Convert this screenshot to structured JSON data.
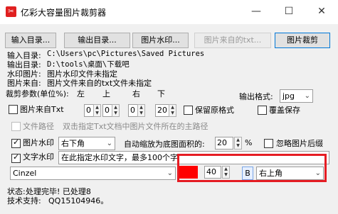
{
  "window": {
    "title": "亿彩大容量图片裁剪器",
    "controls": {
      "minimize": "—",
      "maximize": "☐",
      "close": "✕"
    }
  },
  "toolbar": {
    "input_dir": "输入目录...",
    "output_dir": "输出目录...",
    "watermark_image": "图片水印...",
    "from_txt": "图片来自的txt...",
    "crop": "图片裁剪"
  },
  "info": {
    "input_label": "输入目录:",
    "input_value": "C:\\Users\\pc\\Pictures\\Saved Pictures",
    "output_label": "输出目录:",
    "output_value": "D:\\tools\\桌面\\下载吧",
    "watermark_label": "水印图片:",
    "watermark_value": "图片水印文件未指定",
    "source_label": "图片来自:",
    "source_value": "图片文件来自的txt文件未指定"
  },
  "crop_params": {
    "label": "裁剪参数(单位%):",
    "left": "左",
    "top": "上",
    "right": "右",
    "bottom": "下",
    "values": [
      "0",
      "0",
      "0",
      "20"
    ]
  },
  "output_format": {
    "label": "输出格式:",
    "value": "jpg"
  },
  "options": {
    "from_txt": "图片来自Txt",
    "keep_format": "保留原格式",
    "overwrite": "覆盖保存",
    "file_path": "文件路径",
    "file_path_hint": "双击指定Txt文档中图片文件所在的主路径",
    "image_watermark": "图片水印",
    "watermark_position": "右下角",
    "auto_scale_label": "自动缩放为底图面积的:",
    "auto_scale_value": "20",
    "auto_scale_unit": "%",
    "ignore_small": "忽略图片后缀",
    "text_watermark": "文字水印",
    "text_watermark_value": "在此指定水印文字，最多100个字",
    "font": "Cinzel",
    "font_size": "40",
    "bold": "B",
    "text_position": "右上角"
  },
  "colors": {
    "text_color": "#ff0000",
    "accent": "#e51c23"
  },
  "status": {
    "label": "状态:",
    "value": "处理完毕! 已处理8",
    "support_label": "技术支持:",
    "support_value": "QQ15104946。"
  }
}
